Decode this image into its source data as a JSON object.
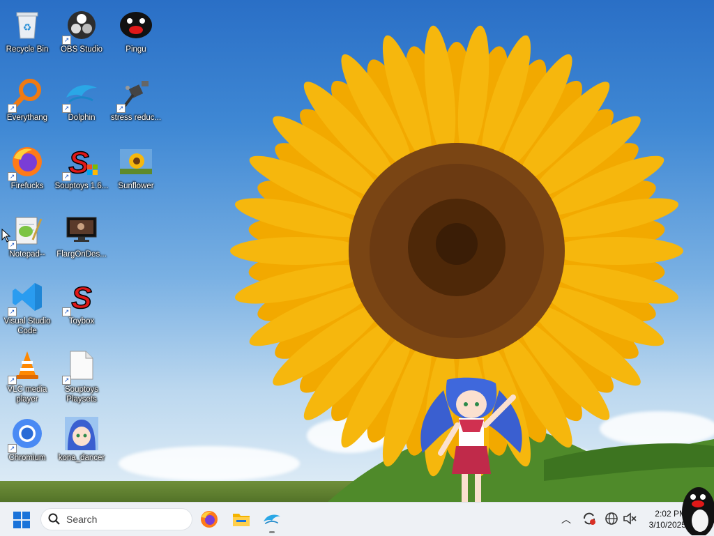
{
  "desktop_icons": [
    {
      "label": "Recycle Bin"
    },
    {
      "label": "OBS Studio"
    },
    {
      "label": "Pingu"
    },
    {
      "label": "Everythang"
    },
    {
      "label": "Dolphin"
    },
    {
      "label": "stress reduc..."
    },
    {
      "label": "Firefucks"
    },
    {
      "label": "Souptoys 1.6..."
    },
    {
      "label": "Sunflower"
    },
    {
      "label": "Notepad--"
    },
    {
      "label": "FlargOnDes..."
    },
    {
      "label": "Visual Studio Code"
    },
    {
      "label": "Toybox"
    },
    {
      "label": "VLC media player"
    },
    {
      "label": "Souptoys Playsets"
    },
    {
      "label": "Chromium"
    },
    {
      "label": "kona_dancer"
    }
  ],
  "taskbar": {
    "search_label": "Search",
    "apps": [
      "firefox-icon",
      "file-explorer-icon",
      "dolphin-icon"
    ],
    "clock_time": "2:02 PM",
    "clock_date": "3/10/2025"
  },
  "colors": {
    "sky_top": "#2a6fc6",
    "petal": "#f6b70d",
    "seed_center": "#6b3a12",
    "taskbar_bg": "#eef1f5"
  }
}
